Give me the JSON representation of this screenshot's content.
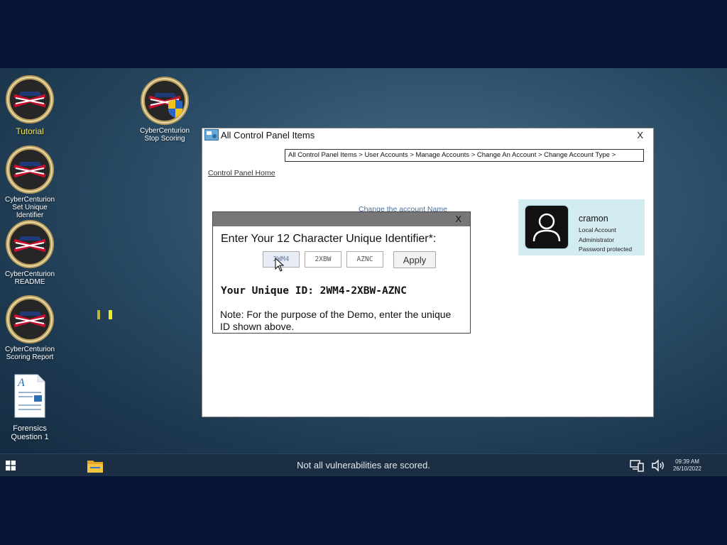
{
  "desktop": {
    "icons": [
      {
        "label": "Tutorial"
      },
      {
        "label": "CyberCenturion Set Unique Identifier"
      },
      {
        "label": "CyberCenturion README"
      },
      {
        "label": "CyberCenturion Scoring Report"
      },
      {
        "label": "Forensics Question 1"
      },
      {
        "label": "CyberCenturion Stop Scoring"
      }
    ]
  },
  "control_panel": {
    "title": "All Control Panel Items",
    "close_label": "X",
    "breadcrumb": "All Control Panel Items > User Accounts > Manage Accounts > Change An Account > Change Account Type >",
    "home_link": "Control Panel Home",
    "change_name_link": "Change the account Name",
    "account": {
      "name": "cramon",
      "type": "Local Account",
      "role": "Administrator",
      "protection": "Password protected"
    }
  },
  "uid_dialog": {
    "close_label": "X",
    "prompt": "Enter Your 12 Character Unique Identifier*:",
    "inputs": [
      "2WM4",
      "2XBW",
      "AZNC"
    ],
    "apply_label": "Apply",
    "unique_id_text": "Your Unique ID: 2WM4-2XBW-AZNC",
    "note": "Note: For the purpose of the Demo, enter the unique ID shown above."
  },
  "taskbar": {
    "status": "Not all vulnerabilities are scored.",
    "time": "09:39 AM",
    "date": "26/10/2022"
  },
  "colors": {
    "desktop_bg": "#2e506a",
    "frame_bg": "#061634",
    "taskbar_bg": "#1b2e44",
    "tutorial_label": "#f2e25a",
    "account_card_bg": "#d3ecf2",
    "dialog_titlebar": "#777777"
  }
}
